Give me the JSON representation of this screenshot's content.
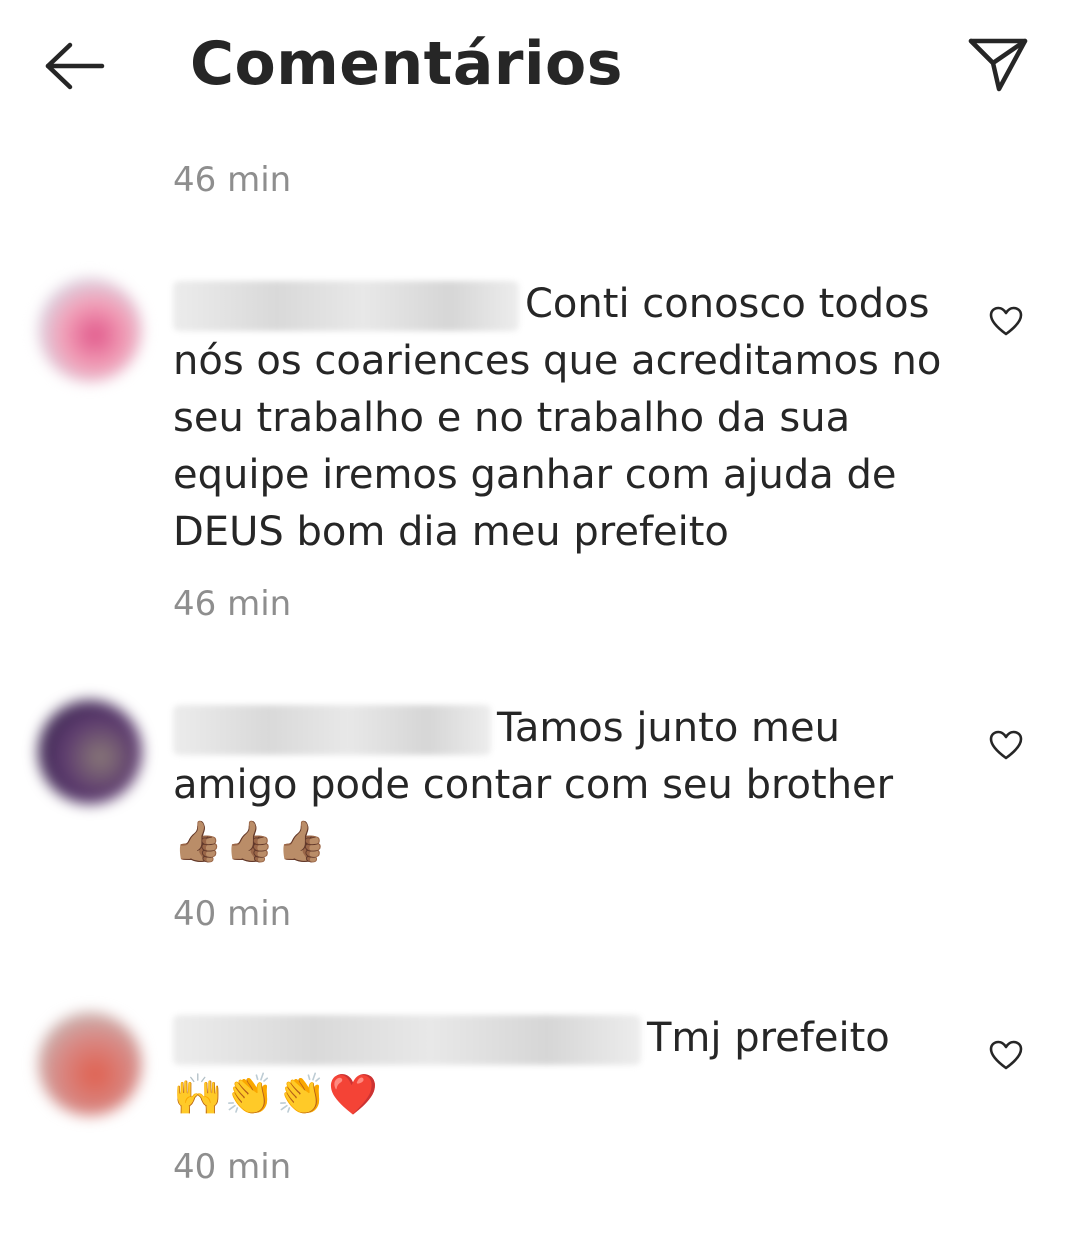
{
  "header": {
    "title": "Comentários"
  },
  "top_timestamp": "46 min",
  "comments": [
    {
      "username": "ygor_santos180",
      "text": "Conti conosco todos nós os coariences  que acreditamos no seu trabalho e no trabalho da sua equipe iremos ganhar com ajuda de DEUS bom dia meu prefeito",
      "emojis": "",
      "time": "46 min",
      "avatar_color": "#e57fa0"
    },
    {
      "username": "ernelsoncarlos",
      "text": "Tamos junto meu amigo pode contar com seu brother",
      "emojis": "👍🏽👍🏽👍🏽",
      "time": "40 min",
      "avatar_color": "#6b4a7a"
    },
    {
      "username": "santosjorgesantos124",
      "text": "Tmj prefeito",
      "emojis": "🙌👏👏❤️",
      "time": "40 min",
      "avatar_color": "#d9807a"
    }
  ],
  "colors": {
    "text": "#262626",
    "secondary_text": "#8e8e8e",
    "background": "#ffffff"
  },
  "icons": {
    "back": "arrow-left-icon",
    "send": "paper-plane-icon",
    "like": "heart-outline-icon"
  }
}
